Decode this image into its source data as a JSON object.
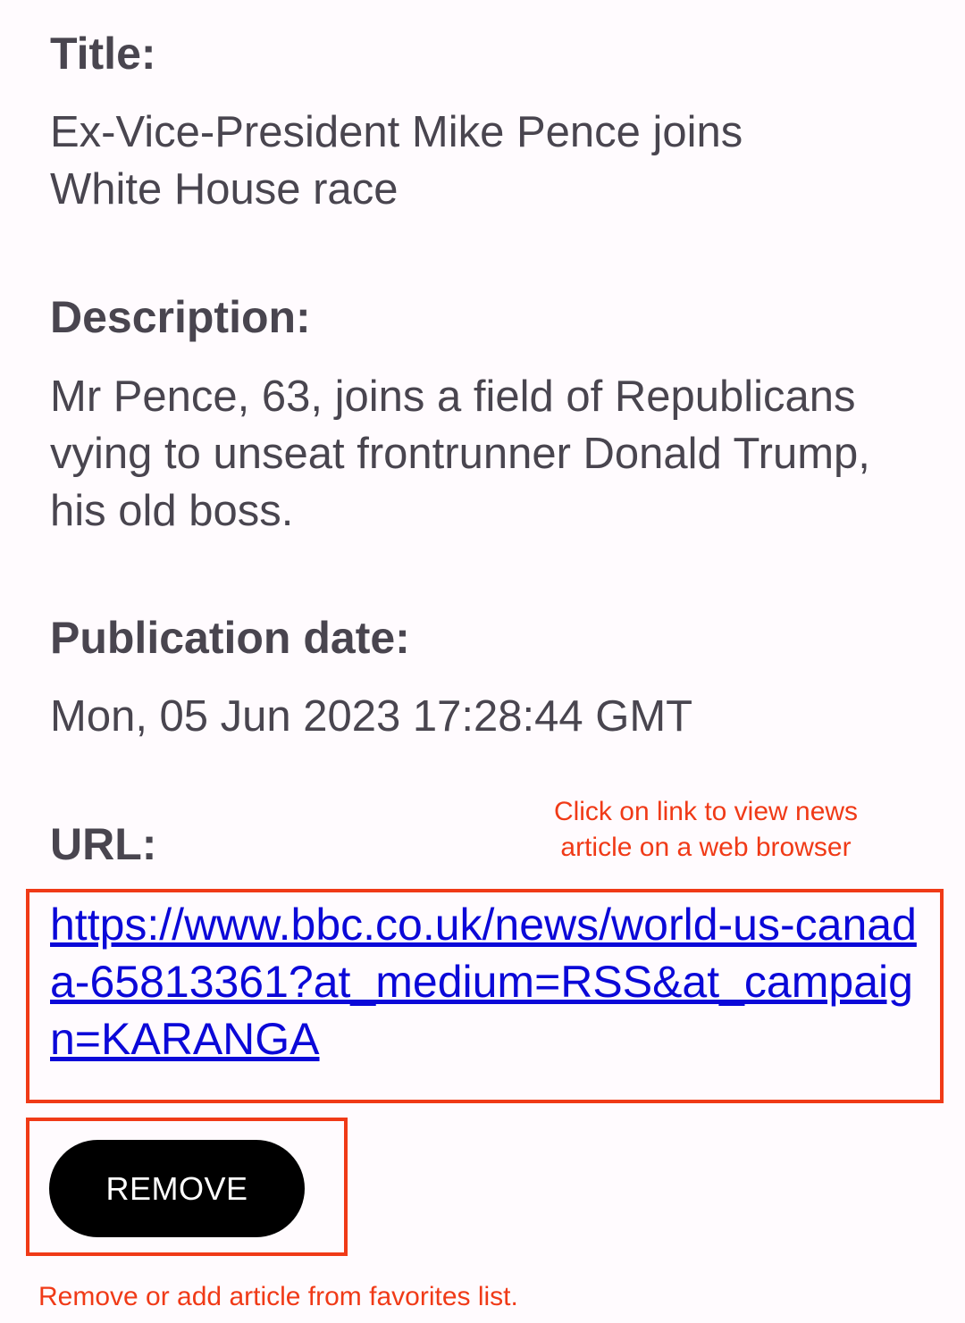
{
  "article": {
    "title_label": "Title:",
    "title": "Ex-Vice-President Mike Pence joins White House race",
    "description_label": "Description:",
    "description": "Mr Pence, 63, joins a field of Republicans vying to unseat frontrunner Donald Trump, his old boss.",
    "date_label": "Publication date:",
    "date": "Mon, 05 Jun 2023 17:28:44 GMT",
    "url_label": "URL:",
    "url": "https://www.bbc.co.uk/news/world-us-canada-65813361?at_medium=RSS&at_campaign=KARANGA"
  },
  "actions": {
    "remove_label": "REMOVE"
  },
  "annotations": {
    "link_hint_line1": "Click on link to view news",
    "link_hint_line2": "article on a web browser",
    "remove_hint": "Remove or add article from favorites list."
  },
  "colors": {
    "background": "#fffbfe",
    "text": "#49454f",
    "link": "#0b08d8",
    "annotation": "#f03a17",
    "button": "#000000"
  }
}
